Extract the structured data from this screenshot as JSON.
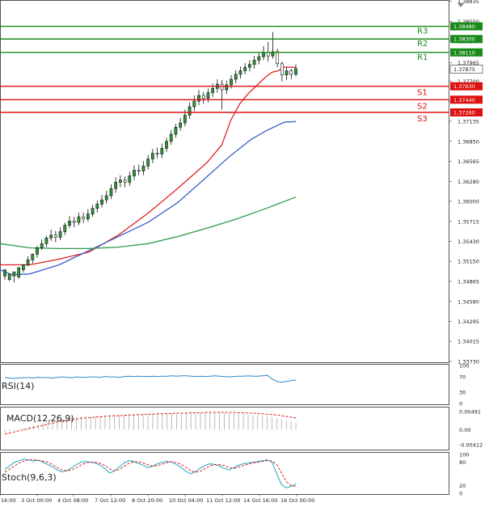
{
  "chart_data": {
    "type": "candlestick",
    "x_ticks": [
      "16:00",
      "3 Oct 00:00",
      "4 Oct 08:00",
      "7 Oct 12:00",
      "8 Oct 20:00",
      "10 Oct 04:00",
      "11 Oct 12:00",
      "14 Oct 16:00",
      "16 Oct 00:00"
    ],
    "y_ticks": [
      "1.38835",
      "1.38550",
      "1.38270",
      "1.37965",
      "1.37700",
      "1.37415",
      "1.37135",
      "1.36850",
      "1.36565",
      "1.36280",
      "1.36000",
      "1.35715",
      "1.35430",
      "1.35150",
      "1.34865",
      "1.34580",
      "1.34295",
      "1.34015",
      "1.33730"
    ],
    "ylim": [
      1.3373,
      1.3883
    ],
    "current_price": "1.37875",
    "levels": [
      {
        "name": "R3",
        "value": 1.3848,
        "label": "1.38480",
        "color": "#1a8a1a"
      },
      {
        "name": "R2",
        "value": 1.383,
        "label": "1.38300",
        "color": "#1a8a1a"
      },
      {
        "name": "R1",
        "value": 1.3811,
        "label": "1.38110",
        "color": "#1a8a1a"
      },
      {
        "name": "S1",
        "value": 1.3763,
        "label": "1.37630",
        "color": "#dd1111"
      },
      {
        "name": "S2",
        "value": 1.3744,
        "label": "1.37440",
        "color": "#dd1111"
      },
      {
        "name": "S3",
        "value": 1.3726,
        "label": "1.37260",
        "color": "#dd1111"
      }
    ],
    "moving_averages": [
      {
        "color": "#e02020",
        "points": [
          [
            0,
            1.351
          ],
          [
            10,
            1.351
          ],
          [
            20,
            1.3518
          ],
          [
            30,
            1.3528
          ],
          [
            40,
            1.3552
          ],
          [
            50,
            1.3583
          ],
          [
            60,
            1.3618
          ],
          [
            70,
            1.3655
          ],
          [
            75,
            1.368
          ],
          [
            78,
            1.3715
          ],
          [
            81,
            1.3738
          ],
          [
            84,
            1.3753
          ],
          [
            87,
            1.3765
          ],
          [
            90,
            1.3777
          ],
          [
            92,
            1.3783
          ],
          [
            94,
            1.3785
          ],
          [
            96,
            1.379
          ],
          [
            100,
            1.379
          ]
        ]
      },
      {
        "color": "#3a5fcc",
        "points": [
          [
            0,
            1.3503
          ],
          [
            4,
            1.3496
          ],
          [
            10,
            1.3497
          ],
          [
            20,
            1.351
          ],
          [
            30,
            1.353
          ],
          [
            40,
            1.355
          ],
          [
            50,
            1.357
          ],
          [
            60,
            1.3598
          ],
          [
            70,
            1.3635
          ],
          [
            78,
            1.3665
          ],
          [
            85,
            1.3688
          ],
          [
            90,
            1.37
          ],
          [
            96,
            1.3712
          ],
          [
            100,
            1.3713
          ]
        ]
      },
      {
        "color": "#2e9a4a",
        "points": [
          [
            0,
            1.354
          ],
          [
            10,
            1.3534
          ],
          [
            20,
            1.3533
          ],
          [
            30,
            1.3533
          ],
          [
            40,
            1.3535
          ],
          [
            50,
            1.354
          ],
          [
            60,
            1.355
          ],
          [
            70,
            1.3562
          ],
          [
            80,
            1.3575
          ],
          [
            90,
            1.359
          ],
          [
            100,
            1.3606
          ]
        ]
      }
    ],
    "candles": [
      [
        1.3494,
        1.3503,
        1.3502,
        1.3489
      ],
      [
        1.3489,
        1.3497,
        1.3494,
        1.3487
      ],
      [
        1.3494,
        1.35,
        1.3493,
        1.3485
      ],
      [
        1.3493,
        1.3506,
        1.3503,
        1.349
      ],
      [
        1.3503,
        1.351,
        1.3511,
        1.3499
      ],
      [
        1.351,
        1.3517,
        1.3522,
        1.3508
      ],
      [
        1.3517,
        1.3525,
        1.3526,
        1.3512
      ],
      [
        1.3525,
        1.3534,
        1.3537,
        1.352
      ],
      [
        1.3534,
        1.354,
        1.3546,
        1.3531
      ],
      [
        1.354,
        1.3548,
        1.3551,
        1.3535
      ],
      [
        1.3548,
        1.3552,
        1.356,
        1.3544
      ],
      [
        1.3552,
        1.3549,
        1.3558,
        1.3542
      ],
      [
        1.3549,
        1.3557,
        1.3563,
        1.3545
      ],
      [
        1.3557,
        1.3566,
        1.357,
        1.3552
      ],
      [
        1.3566,
        1.3572,
        1.3579,
        1.3562
      ],
      [
        1.3572,
        1.357,
        1.3578,
        1.3563
      ],
      [
        1.357,
        1.3578,
        1.3584,
        1.3566
      ],
      [
        1.3578,
        1.3575,
        1.3584,
        1.3569
      ],
      [
        1.3575,
        1.3582,
        1.3589,
        1.3571
      ],
      [
        1.3582,
        1.359,
        1.3595,
        1.3578
      ],
      [
        1.359,
        1.3596,
        1.3601,
        1.3584
      ],
      [
        1.3596,
        1.3602,
        1.3609,
        1.3591
      ],
      [
        1.3602,
        1.3608,
        1.3615,
        1.3597
      ],
      [
        1.3608,
        1.3618,
        1.3624,
        1.3603
      ],
      [
        1.3618,
        1.3627,
        1.3634,
        1.3612
      ],
      [
        1.3627,
        1.363,
        1.3637,
        1.362
      ],
      [
        1.363,
        1.3627,
        1.3635,
        1.362
      ],
      [
        1.3627,
        1.3636,
        1.3642,
        1.3622
      ],
      [
        1.3636,
        1.3644,
        1.3651,
        1.363
      ],
      [
        1.3644,
        1.3643,
        1.3652,
        1.3637
      ],
      [
        1.3643,
        1.365,
        1.3657,
        1.3637
      ],
      [
        1.365,
        1.366,
        1.3666,
        1.3645
      ],
      [
        1.366,
        1.3668,
        1.3674,
        1.3654
      ],
      [
        1.3668,
        1.3667,
        1.3676,
        1.3661
      ],
      [
        1.3667,
        1.3675,
        1.3682,
        1.3661
      ],
      [
        1.3675,
        1.3685,
        1.369,
        1.367
      ],
      [
        1.3685,
        1.3695,
        1.3701,
        1.368
      ],
      [
        1.3695,
        1.3705,
        1.371,
        1.369
      ],
      [
        1.3705,
        1.3711,
        1.3718,
        1.37
      ],
      [
        1.3711,
        1.3722,
        1.373,
        1.3706
      ],
      [
        1.3722,
        1.3734,
        1.374,
        1.3717
      ],
      [
        1.3734,
        1.3742,
        1.375,
        1.3728
      ],
      [
        1.3742,
        1.375,
        1.3758,
        1.3736
      ],
      [
        1.375,
        1.3746,
        1.3755,
        1.3738
      ],
      [
        1.3746,
        1.3754,
        1.376,
        1.374
      ],
      [
        1.3754,
        1.376,
        1.3767,
        1.3748
      ],
      [
        1.376,
        1.3766,
        1.3773,
        1.3754
      ],
      [
        1.3766,
        1.3758,
        1.3772,
        1.373
      ],
      [
        1.3758,
        1.3765,
        1.3771,
        1.3752
      ],
      [
        1.3765,
        1.3773,
        1.3779,
        1.376
      ],
      [
        1.3773,
        1.378,
        1.3786,
        1.3767
      ],
      [
        1.378,
        1.3785,
        1.3791,
        1.3774
      ],
      [
        1.3785,
        1.379,
        1.3796,
        1.378
      ],
      [
        1.379,
        1.3794,
        1.38,
        1.3784
      ],
      [
        1.3794,
        1.38,
        1.3806,
        1.3788
      ],
      [
        1.38,
        1.3805,
        1.381,
        1.3794
      ],
      [
        1.3805,
        1.3811,
        1.382,
        1.38
      ],
      [
        1.3811,
        1.3806,
        1.3826,
        1.3798
      ],
      [
        1.3806,
        1.3812,
        1.384,
        1.3802
      ],
      [
        1.3812,
        1.3795,
        1.3816,
        1.379
      ],
      [
        1.3795,
        1.3779,
        1.3798,
        1.377
      ],
      [
        1.3779,
        1.3785,
        1.379,
        1.3772
      ],
      [
        1.3785,
        1.378,
        1.3788,
        1.3773
      ],
      [
        1.378,
        1.3788,
        1.3794,
        1.3777
      ]
    ]
  },
  "rsi": {
    "title": "RSI(14)",
    "ticks": [
      "100",
      "70",
      "30",
      "0"
    ],
    "values": [
      68,
      67,
      66,
      67,
      68,
      68,
      67,
      69,
      68,
      68,
      67,
      69,
      70,
      69,
      68,
      70,
      69,
      69,
      70,
      70,
      69,
      71,
      70,
      70,
      69,
      71,
      72,
      71,
      72,
      71,
      71,
      72,
      71,
      72,
      72,
      73,
      72,
      73,
      73,
      72,
      71,
      72,
      71,
      72,
      73,
      72,
      71,
      70,
      71,
      72,
      72,
      73,
      72,
      72,
      73,
      74,
      65,
      58,
      56,
      58,
      60,
      62
    ]
  },
  "macd": {
    "title": "MACD(12,26,9)",
    "ticks": [
      "0.00491",
      "0.00",
      "-0.00412"
    ],
    "ylim": [
      -0.0052,
      0.0058
    ],
    "hist": [
      -0.0008,
      -0.0005,
      -0.0002,
      0.0002,
      0.0005,
      0.0008,
      0.0012,
      0.0015,
      0.0018,
      0.0021,
      0.0024,
      0.0027,
      0.0029,
      0.0031,
      0.0033,
      0.0034,
      0.0035,
      0.0036,
      0.0037,
      0.0038,
      0.0038,
      0.0039,
      0.004,
      0.004,
      0.0041,
      0.0041,
      0.0042,
      0.0042,
      0.0043,
      0.0043,
      0.0043,
      0.0044,
      0.0044,
      0.0044,
      0.0045,
      0.0045,
      0.0045,
      0.0046,
      0.0046,
      0.0046,
      0.0046,
      0.0047,
      0.0047,
      0.0047,
      0.0046,
      0.0046,
      0.0045,
      0.0045,
      0.0044,
      0.0043,
      0.0042,
      0.0041,
      0.004,
      0.0039,
      0.0038,
      0.0036,
      0.0034,
      0.0031,
      0.0028,
      0.0025,
      0.0022,
      0.002
    ],
    "signal": [
      -0.0012,
      -0.0009,
      -0.0006,
      -0.0003,
      0.0,
      0.0003,
      0.0006,
      0.0009,
      0.0012,
      0.0015,
      0.0018,
      0.0021,
      0.0023,
      0.0025,
      0.0027,
      0.0029,
      0.0031,
      0.0032,
      0.0033,
      0.0034,
      0.0035,
      0.0036,
      0.0037,
      0.0038,
      0.0038,
      0.0039,
      0.004,
      0.004,
      0.0041,
      0.0041,
      0.0042,
      0.0042,
      0.0043,
      0.0043,
      0.0044,
      0.0044,
      0.0045,
      0.0045,
      0.0045,
      0.0046,
      0.0046,
      0.0046,
      0.0047,
      0.0047,
      0.0047,
      0.0047,
      0.0047,
      0.0047,
      0.0047,
      0.0046,
      0.0046,
      0.0045,
      0.0045,
      0.0044,
      0.0043,
      0.0042,
      0.0041,
      0.004,
      0.0038,
      0.0036,
      0.0034,
      0.0032
    ]
  },
  "stoch": {
    "title": "Stoch(9,6,3)",
    "ticks": [
      "100",
      "80",
      "20",
      "0"
    ],
    "main": [
      62,
      70,
      80,
      84,
      88,
      86,
      83,
      85,
      80,
      74,
      68,
      60,
      55,
      58,
      66,
      74,
      80,
      82,
      80,
      78,
      72,
      63,
      52,
      58,
      68,
      78,
      84,
      82,
      77,
      72,
      66,
      70,
      76,
      80,
      82,
      80,
      74,
      66,
      56,
      50,
      56,
      65,
      72,
      76,
      74,
      70,
      64,
      60,
      66,
      72,
      76,
      78,
      80,
      82,
      84,
      86,
      80,
      50,
      22,
      14,
      18,
      24
    ],
    "signal": [
      55,
      62,
      70,
      78,
      83,
      86,
      86,
      85,
      83,
      80,
      74,
      66,
      60,
      58,
      60,
      66,
      73,
      78,
      80,
      80,
      77,
      71,
      62,
      58,
      61,
      69,
      77,
      81,
      81,
      78,
      73,
      70,
      71,
      75,
      79,
      81,
      79,
      74,
      66,
      58,
      54,
      57,
      64,
      71,
      74,
      74,
      71,
      66,
      64,
      67,
      71,
      75,
      78,
      80,
      82,
      84,
      83,
      74,
      52,
      30,
      20,
      18
    ]
  }
}
